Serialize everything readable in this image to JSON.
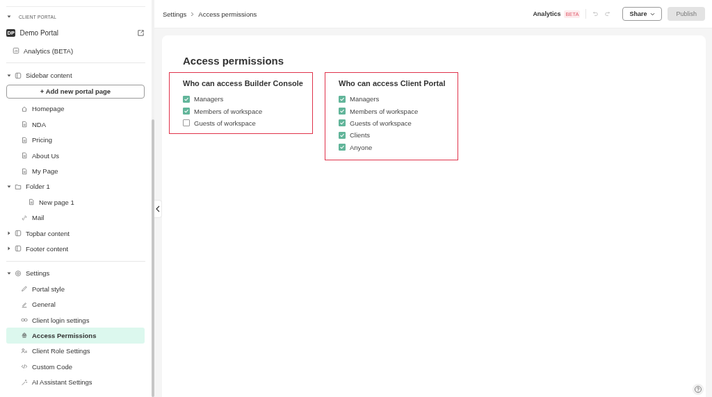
{
  "sidebar": {
    "section_label": "CLIENT PORTAL",
    "section_expanded": true,
    "portal": {
      "badge": "DP",
      "name": "Demo Portal"
    },
    "analytics_link": "Analytics (BETA)",
    "tree": [
      {
        "label": "Sidebar content",
        "kind": "group",
        "expanded": true,
        "add_button": "+ Add new portal page",
        "children": [
          {
            "label": "Homepage",
            "kind": "home"
          },
          {
            "label": "NDA",
            "kind": "page"
          },
          {
            "label": "Pricing",
            "kind": "page"
          },
          {
            "label": "About Us",
            "kind": "page"
          },
          {
            "label": "My Page",
            "kind": "page"
          },
          {
            "label": "Folder 1",
            "kind": "folder",
            "expanded": true,
            "children": [
              {
                "label": "New page 1",
                "kind": "page"
              }
            ]
          },
          {
            "label": "Mail",
            "kind": "link"
          }
        ]
      },
      {
        "label": "Topbar content",
        "kind": "group",
        "expanded": false
      },
      {
        "label": "Footer content",
        "kind": "group",
        "expanded": false
      }
    ],
    "settings": {
      "label": "Settings",
      "expanded": true,
      "items": [
        {
          "label": "Portal style",
          "kind": "style",
          "selected": false
        },
        {
          "label": "General",
          "kind": "general",
          "selected": false
        },
        {
          "label": "Client login settings",
          "kind": "login",
          "selected": false
        },
        {
          "label": "Access Permissions",
          "kind": "access",
          "selected": true
        },
        {
          "label": "Client Role Settings",
          "kind": "roles",
          "selected": false
        },
        {
          "label": "Custom Code",
          "kind": "code",
          "selected": false
        },
        {
          "label": "AI Assistant Settings",
          "kind": "ai",
          "selected": false
        }
      ]
    }
  },
  "header": {
    "breadcrumb": [
      "Settings",
      "Access permissions"
    ],
    "analytics": "Analytics",
    "analytics_badge": "BETA",
    "share": "Share",
    "publish": {
      "label": "Publish",
      "disabled": true
    }
  },
  "page": {
    "title": "Access permissions",
    "groups": [
      {
        "title": "Who can access Builder Console",
        "options": [
          {
            "label": "Managers",
            "checked": true
          },
          {
            "label": "Members of workspace",
            "checked": true
          },
          {
            "label": "Guests of workspace",
            "checked": false
          }
        ]
      },
      {
        "title": "Who can access Client Portal",
        "options": [
          {
            "label": "Managers",
            "checked": true
          },
          {
            "label": "Members of workspace",
            "checked": true
          },
          {
            "label": "Guests of workspace",
            "checked": true
          },
          {
            "label": "Clients",
            "checked": true
          },
          {
            "label": "Anyone",
            "checked": true
          }
        ]
      }
    ]
  }
}
